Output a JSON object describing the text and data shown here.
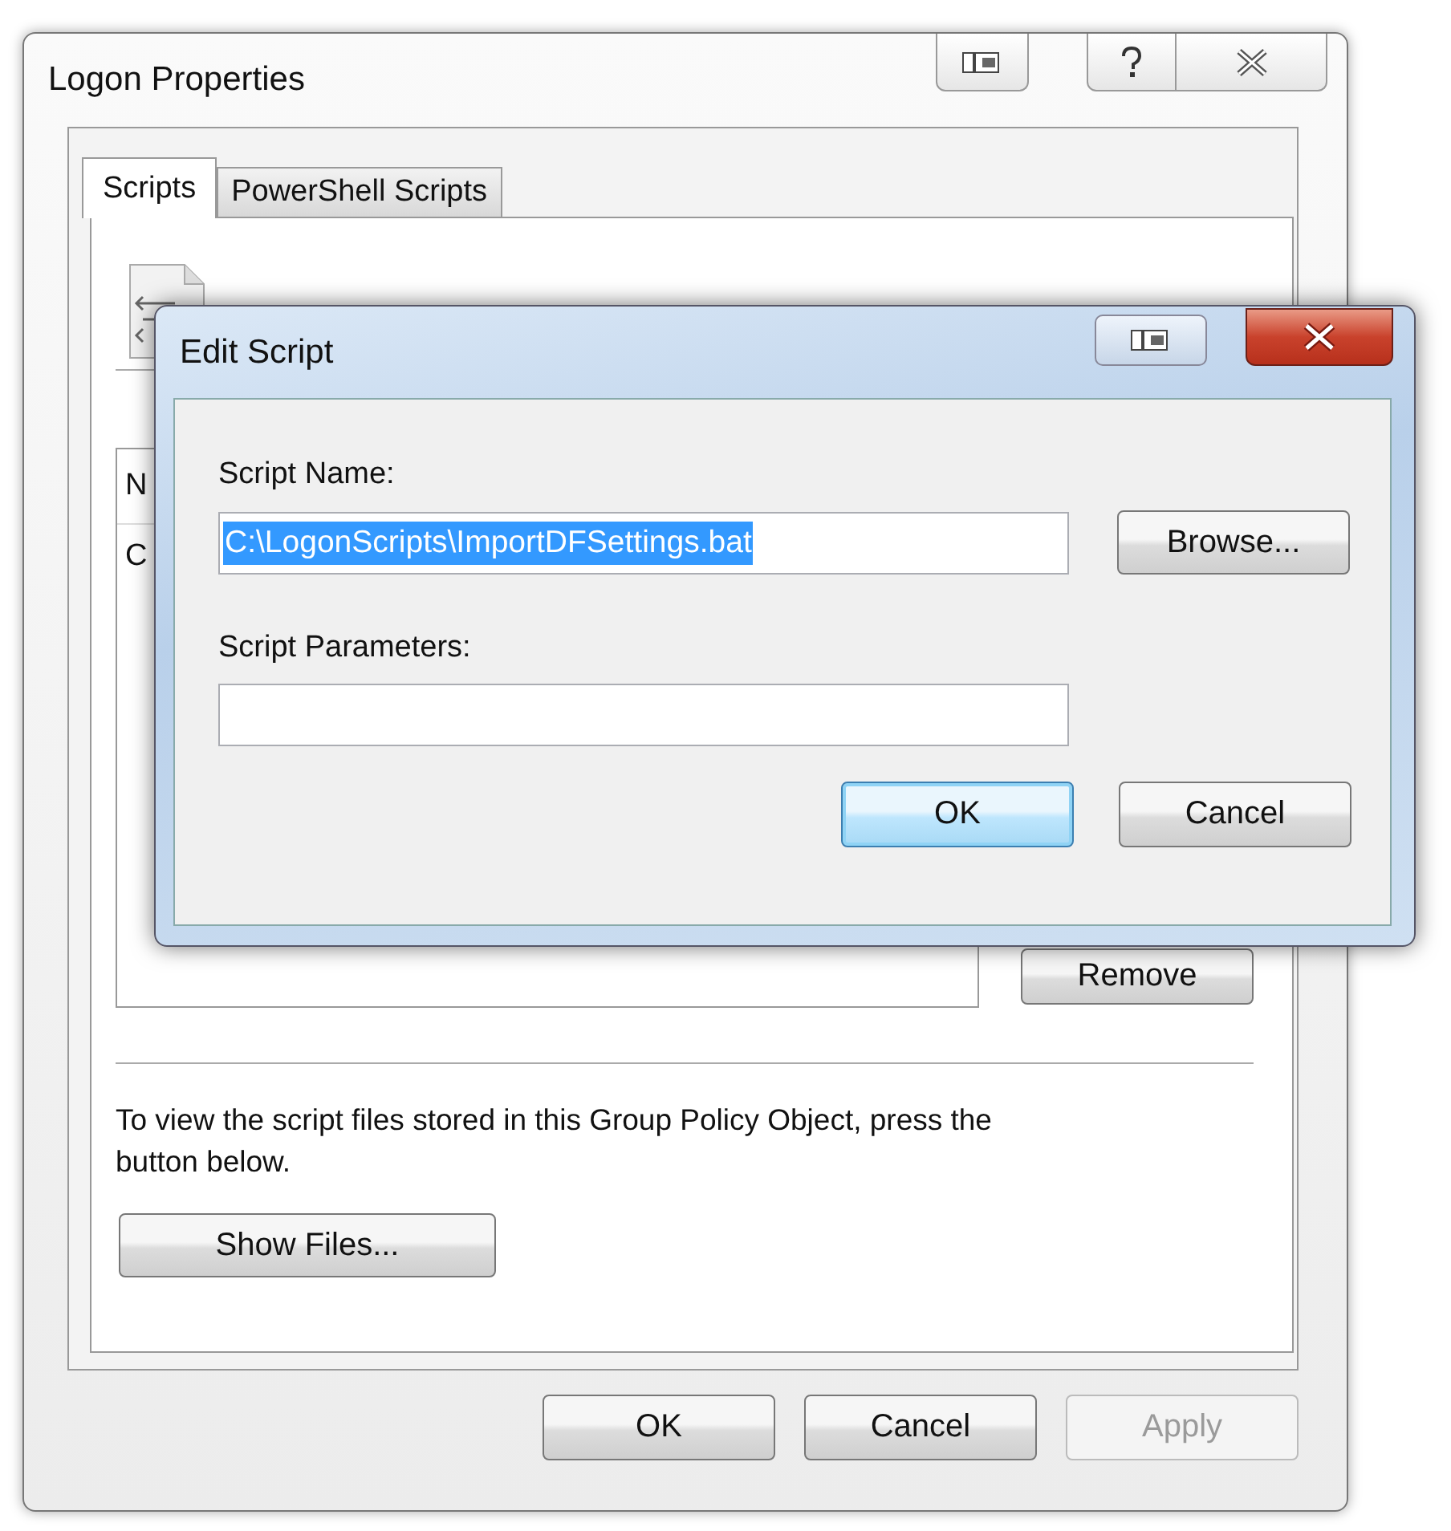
{
  "logon_window": {
    "title": "Logon Properties",
    "tabs": [
      {
        "label": "Scripts",
        "selected": true
      },
      {
        "label": "PowerShell Scripts",
        "selected": false
      }
    ],
    "list": {
      "column_1": "N",
      "rows": [
        "C"
      ]
    },
    "remove_button": "Remove",
    "description": "To view the script files stored in this Group Policy Object, press the button below.",
    "show_files_button": "Show Files...",
    "buttons": [
      {
        "label": "OK",
        "disabled": false
      },
      {
        "label": "Cancel",
        "disabled": false
      },
      {
        "label": "Apply",
        "disabled": true
      }
    ]
  },
  "edit_dialog": {
    "title": "Edit Script",
    "fields": [
      {
        "label": "Script Name:",
        "value": "C:\\LogonScripts\\ImportDFSettings.bat",
        "text_selected": true
      },
      {
        "label": "Script Parameters:"
      }
    ],
    "browse_button": "Browse...",
    "buttons": [
      {
        "label": "OK",
        "default": true
      },
      {
        "label": "Cancel",
        "default": false
      }
    ]
  }
}
